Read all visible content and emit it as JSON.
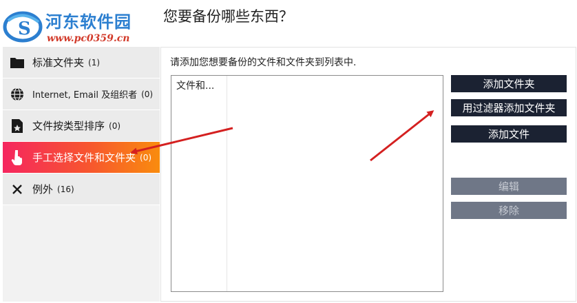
{
  "watermark": {
    "site_name": "河东软件园",
    "url": "www.pc0359.cn"
  },
  "header": {
    "title": "您要备份哪些东西？"
  },
  "sidebar": {
    "items": [
      {
        "label": "标准文件夹",
        "count": "(1)",
        "icon": "folder-icon"
      },
      {
        "label": "Internet, Email 及组织者",
        "count": "(0)",
        "icon": "globe-icon"
      },
      {
        "label": "文件按类型排序",
        "count": "(0)",
        "icon": "file-star-icon"
      },
      {
        "label": "手工选择文件和文件夹",
        "count": "(0)",
        "icon": "hand-pointer-icon",
        "active": true
      },
      {
        "label": "例外",
        "count": "(16)",
        "icon": "x-icon"
      }
    ]
  },
  "main": {
    "instruction": "请添加您想要备份的文件和文件夹到列表中.",
    "list": {
      "column_header": "文件和..."
    },
    "buttons": {
      "add_folder": "添加文件夹",
      "add_folder_filter": "用过滤器添加文件夹",
      "add_file": "添加文件",
      "edit": "编辑",
      "remove": "移除"
    }
  },
  "colors": {
    "accent_start": "#f5265f",
    "accent_end": "#f98c0e",
    "button": "#1b2232",
    "button_disabled": "#6f7787",
    "arrow": "#d42020"
  }
}
